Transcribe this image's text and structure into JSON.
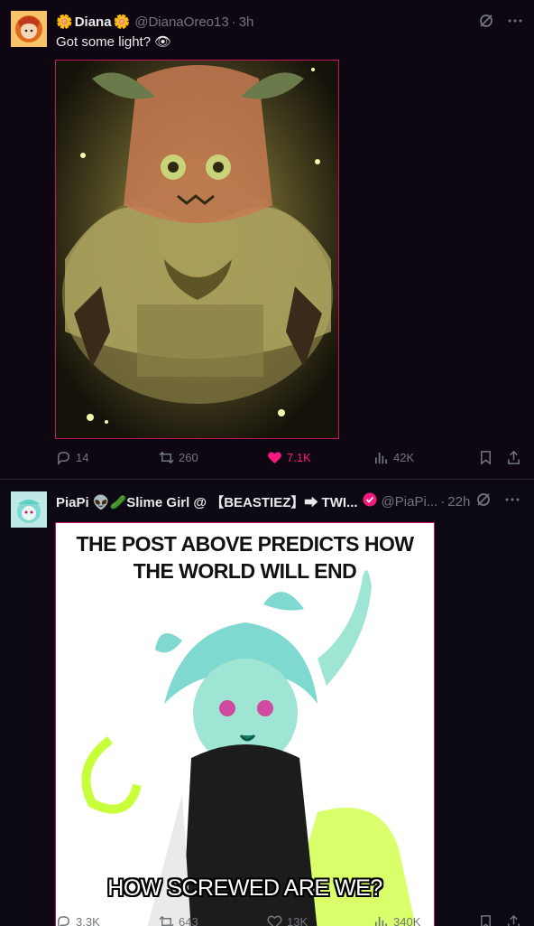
{
  "posts": [
    {
      "display_name": "Diana",
      "name_emoji": "🌼",
      "handle": "@DianaOreo13",
      "dot": "·",
      "time": "3h",
      "text": "Got some light?",
      "text_emoji": "👁",
      "stats": {
        "replies": "14",
        "reposts": "260",
        "likes": "7.1K",
        "views": "42K"
      }
    },
    {
      "display_name": "PiaPi 👽🥒Slime Girl @ 【BEASTIEZ】➡ TWI...",
      "handle": "@PiaPi...",
      "dot": "·",
      "time": "22h",
      "meme_top": "THE POST ABOVE PREDICTS HOW THE WORLD WILL END",
      "meme_bottom": "HOW SCREWED ARE WE?",
      "stats": {
        "replies": "3.3K",
        "reposts": "643",
        "likes": "13K",
        "views": "340K"
      }
    }
  ],
  "colors": {
    "like_active": "#f91880",
    "muted": "#71767b",
    "verified": "#f91880",
    "media_border": "#c2185b"
  },
  "icons": [
    "grok-icon",
    "more-icon",
    "reply-icon",
    "repost-icon",
    "like-icon",
    "views-icon",
    "bookmark-icon",
    "share-icon"
  ]
}
